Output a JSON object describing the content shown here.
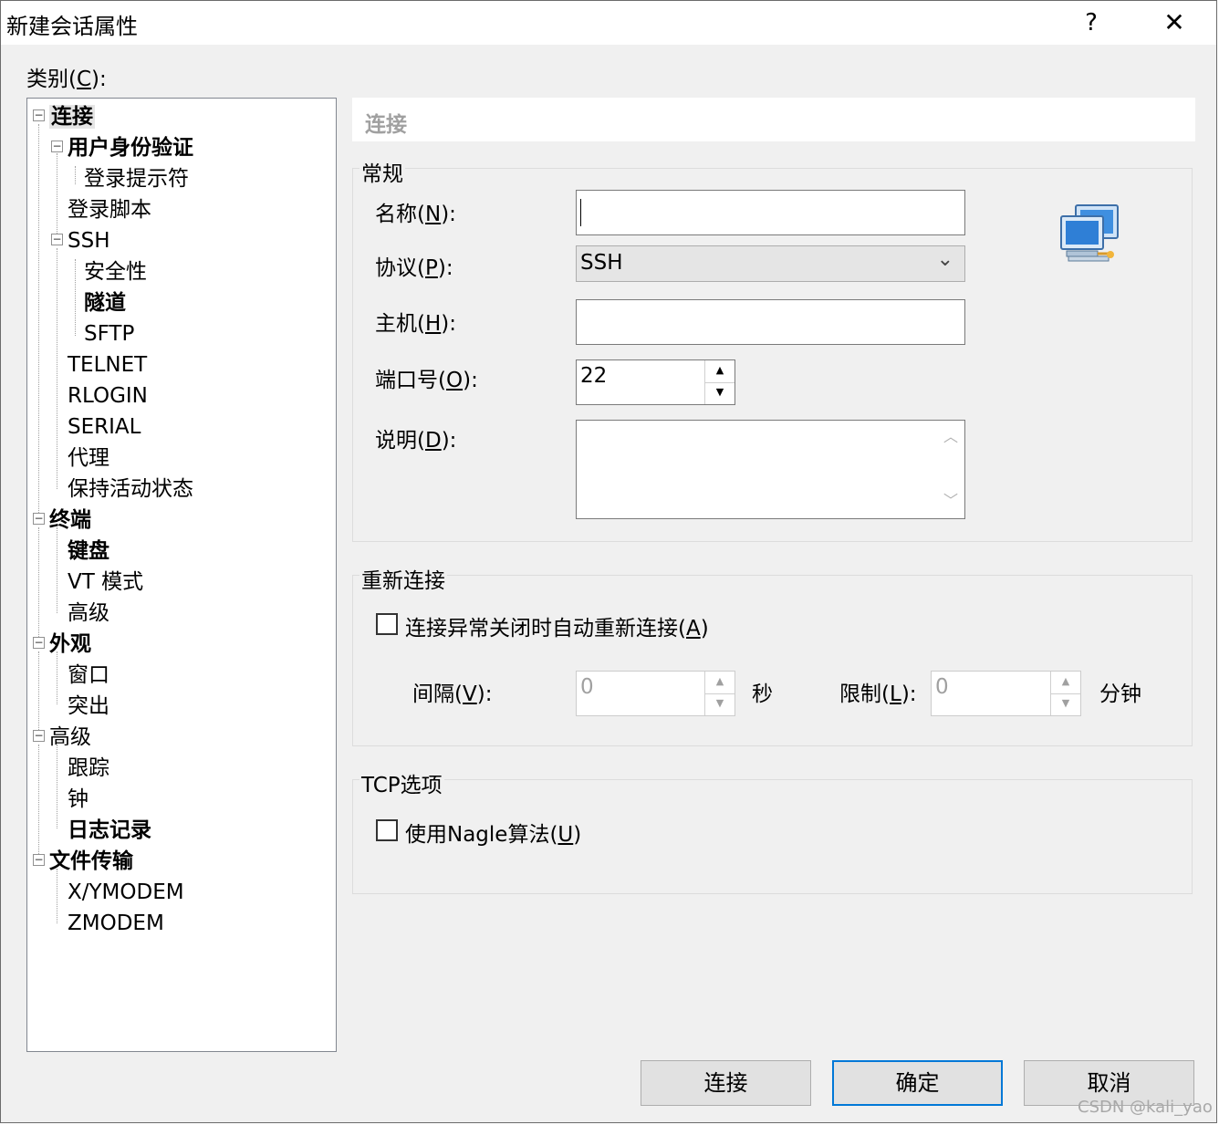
{
  "window": {
    "title": "新建会话属性",
    "help_label": "?",
    "close_label": "✕"
  },
  "category": {
    "label_prefix": "类别(",
    "label_key": "C",
    "label_suffix": "):"
  },
  "tree": [
    {
      "label": "连接",
      "bold": true,
      "selected": true
    },
    {
      "label": "用户身份验证",
      "bold": true
    },
    {
      "label": "登录提示符",
      "bold": false
    },
    {
      "label": "登录脚本",
      "bold": false
    },
    {
      "label": "SSH",
      "bold": false
    },
    {
      "label": "安全性",
      "bold": false
    },
    {
      "label": "隧道",
      "bold": true
    },
    {
      "label": "SFTP",
      "bold": false
    },
    {
      "label": "TELNET",
      "bold": false
    },
    {
      "label": "RLOGIN",
      "bold": false
    },
    {
      "label": "SERIAL",
      "bold": false
    },
    {
      "label": "代理",
      "bold": false
    },
    {
      "label": "保持活动状态",
      "bold": false
    },
    {
      "label": "终端",
      "bold": true
    },
    {
      "label": "键盘",
      "bold": true
    },
    {
      "label": "VT 模式",
      "bold": false
    },
    {
      "label": "高级",
      "bold": false
    },
    {
      "label": "外观",
      "bold": true
    },
    {
      "label": "窗口",
      "bold": false
    },
    {
      "label": "突出",
      "bold": false
    },
    {
      "label": "高级",
      "bold": false
    },
    {
      "label": "跟踪",
      "bold": false
    },
    {
      "label": "钟",
      "bold": false
    },
    {
      "label": "日志记录",
      "bold": true
    },
    {
      "label": "文件传输",
      "bold": true
    },
    {
      "label": "X/YMODEM",
      "bold": false
    },
    {
      "label": "ZMODEM",
      "bold": false
    }
  ],
  "expander_symbol": "−",
  "header": {
    "title": "连接"
  },
  "general": {
    "title": "常规",
    "name": {
      "prefix": "名称(",
      "key": "N",
      "suffix": "):",
      "value": ""
    },
    "protocol": {
      "prefix": "协议(",
      "key": "P",
      "suffix": "):",
      "value": "SSH"
    },
    "host": {
      "prefix": "主机(",
      "key": "H",
      "suffix": "):",
      "value": ""
    },
    "port": {
      "prefix": "端口号(",
      "key": "O",
      "suffix": "):",
      "value": "22"
    },
    "description": {
      "prefix": "说明(",
      "key": "D",
      "suffix": "):",
      "value": ""
    }
  },
  "reconnect": {
    "title": "重新连接",
    "checkbox": {
      "prefix": "连接异常关闭时自动重新连接(",
      "key": "A",
      "suffix": ")",
      "checked": false
    },
    "interval": {
      "prefix": "间隔(",
      "key": "V",
      "suffix": "):",
      "value": "0",
      "unit": "秒"
    },
    "limit": {
      "prefix": "限制(",
      "key": "L",
      "suffix": "):",
      "value": "0",
      "unit": "分钟"
    }
  },
  "tcp": {
    "title": "TCP选项",
    "checkbox": {
      "prefix": "使用Nagle算法(",
      "key": "U",
      "suffix": ")",
      "checked": false
    }
  },
  "buttons": {
    "connect": "连接",
    "ok": "确定",
    "cancel": "取消"
  },
  "watermark": "CSDN @kali_yao",
  "arrows": {
    "up": "▲",
    "down": "▼",
    "combo": "⌄",
    "scroll_up": "︿",
    "scroll_down": "﹀"
  }
}
